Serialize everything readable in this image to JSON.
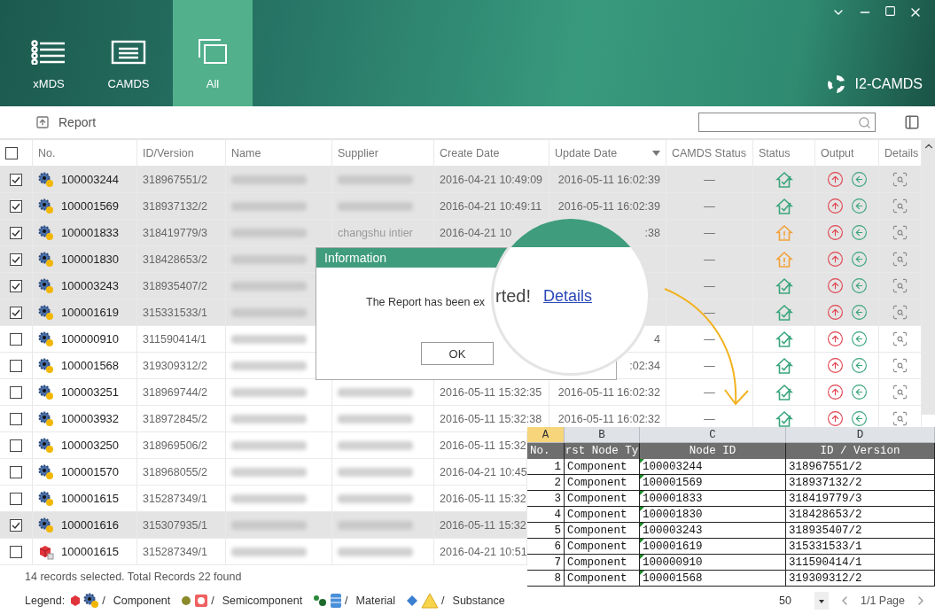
{
  "nav": {
    "tabs": [
      {
        "label": "xMDS",
        "kind": "list",
        "selected": false
      },
      {
        "label": "CAMDS",
        "kind": "card",
        "selected": false
      },
      {
        "label": "All",
        "kind": "stack",
        "selected": true
      }
    ]
  },
  "brand": {
    "name": "I2-CAMDS"
  },
  "toolbar": {
    "report": "Report"
  },
  "table": {
    "select_all": {
      "checked": false
    },
    "columns": [
      {
        "label": "No.",
        "sorted": false
      },
      {
        "label": "ID/Version",
        "sorted": false
      },
      {
        "label": "Name",
        "sorted": false
      },
      {
        "label": "Supplier",
        "sorted": false
      },
      {
        "label": "Create Date",
        "sorted": false
      },
      {
        "label": "Update Date",
        "sorted": true
      },
      {
        "label": "CAMDS Status",
        "sorted": false
      },
      {
        "label": "Status",
        "sorted": false
      },
      {
        "label": "Output",
        "sorted": false
      },
      {
        "label": "Details",
        "sorted": false
      }
    ],
    "rows": [
      {
        "checked": true,
        "kind": "gear",
        "no": "100003244",
        "id": "318967551/2",
        "name_redacted": true,
        "supplier_redacted": true,
        "create": "2016-04-21 10:49:09",
        "update": "2016-05-11 16:02:39",
        "camds": "—",
        "warning": false,
        "covered": false
      },
      {
        "checked": true,
        "kind": "gear",
        "no": "100001569",
        "id": "318937132/2",
        "name_redacted": true,
        "supplier_redacted": true,
        "create": "2016-04-21 10:49:11",
        "update": "2016-05-11 16:02:39",
        "camds": "—",
        "warning": false,
        "covered": false
      },
      {
        "checked": true,
        "kind": "gear",
        "no": "100001833",
        "id": "318419779/3",
        "name_redacted": true,
        "supplier": "changshu intier",
        "create": "2016-04-21 10",
        "update": ":38",
        "camds": "—",
        "warning": true,
        "covered": false
      },
      {
        "checked": true,
        "kind": "gear",
        "no": "100001830",
        "id": "318428653/2",
        "name_redacted": true,
        "camds": "—",
        "warning": true,
        "covered": false
      },
      {
        "checked": true,
        "kind": "gear",
        "no": "100003243",
        "id": "318935407/2",
        "name_redacted": true,
        "camds": "—",
        "warning": false,
        "covered": false
      },
      {
        "checked": true,
        "kind": "gear",
        "no": "100001619",
        "id": "315331533/1",
        "name_redacted": true,
        "camds": "—",
        "warning": false,
        "covered": false
      },
      {
        "checked": false,
        "kind": "gear",
        "no": "100000910",
        "id": "311590414/1",
        "name_redacted": true,
        "update": "4",
        "camds": "—",
        "warning": false,
        "covered": false
      },
      {
        "checked": false,
        "kind": "gear",
        "no": "100001568",
        "id": "319309312/2",
        "name_redacted": true,
        "update": ":02:34",
        "camds": "—",
        "warning": false,
        "covered": false
      },
      {
        "checked": false,
        "kind": "gear",
        "no": "100003251",
        "id": "318969744/2",
        "name_redacted": true,
        "supplier_redacted": true,
        "create": "2016-05-11 15:32:35",
        "update": "2016-05-11 16:02:32",
        "camds": "—",
        "warning": false,
        "covered": false
      },
      {
        "checked": false,
        "kind": "gear",
        "no": "100003932",
        "id": "318972845/2",
        "name_redacted": true,
        "supplier_redacted": true,
        "create": "2016-05-11 15:32:38",
        "update": "2016-05-11 16:02:32",
        "camds": "—",
        "warning": false,
        "covered": false
      },
      {
        "checked": false,
        "kind": "gear",
        "no": "100003250",
        "id": "318969506/2",
        "name_redacted": true,
        "supplier_redacted": true,
        "create": "2016-05-11 15:32",
        "covered": true
      },
      {
        "checked": false,
        "kind": "gear",
        "no": "100001570",
        "id": "318968055/2",
        "name_redacted": true,
        "supplier_redacted": true,
        "create": "2016-04-21 10:45",
        "covered": true
      },
      {
        "checked": false,
        "kind": "gear",
        "no": "100001615",
        "id": "315287349/1",
        "name_redacted": true,
        "supplier_redacted": true,
        "create": "2016-05-11 15:32",
        "covered": true
      },
      {
        "checked": true,
        "kind": "gear",
        "no": "100001616",
        "id": "315307935/1",
        "name_redacted": true,
        "supplier_redacted": true,
        "create": "2016-05-11 15:32",
        "covered": true
      },
      {
        "checked": false,
        "kind": "cube",
        "no": "100001615",
        "id": "315287349/1",
        "name_redacted": true,
        "supplier_redacted": true,
        "create": "2016-04-21 10:51",
        "covered": true
      }
    ]
  },
  "status_bar": {
    "summary": "14 records selected. Total Records 22 found",
    "legend_label": "Legend:",
    "legend": [
      {
        "kind": "component",
        "separator": "/",
        "label": "Component"
      },
      {
        "kind": "semicomponent",
        "separator": "/",
        "label": "Semicomponent"
      },
      {
        "kind": "material",
        "separator": "/",
        "label": "Material"
      },
      {
        "kind": "substance",
        "separator": "/",
        "label": "Substance"
      }
    ],
    "page_size": "50",
    "page": "1/1 Page"
  },
  "dialog": {
    "title": "Information",
    "message": "The Report has been ex",
    "button": "OK"
  },
  "magnifier": {
    "text": "rted!",
    "link": "Details"
  },
  "spreadsheet": {
    "letters": [
      {
        "label": "A",
        "selected": true
      },
      {
        "label": "B",
        "selected": false
      },
      {
        "label": "C",
        "selected": false
      },
      {
        "label": "D",
        "selected": false
      }
    ],
    "header": [
      "No.",
      "rst Node Ty",
      "Node ID",
      "ID / Version"
    ],
    "rows": [
      [
        "1",
        "Component",
        "100003244",
        "318967551/2"
      ],
      [
        "2",
        "Component",
        "100001569",
        "318937132/2"
      ],
      [
        "3",
        "Component",
        "100001833",
        "318419779/3"
      ],
      [
        "4",
        "Component",
        "100001830",
        "318428653/2"
      ],
      [
        "5",
        "Component",
        "100003243",
        "318935407/2"
      ],
      [
        "6",
        "Component",
        "100001619",
        "315331533/1"
      ],
      [
        "7",
        "Component",
        "100000910",
        "311590414/1"
      ],
      [
        "8",
        "Component",
        "100001568",
        "319309312/2"
      ]
    ]
  }
}
